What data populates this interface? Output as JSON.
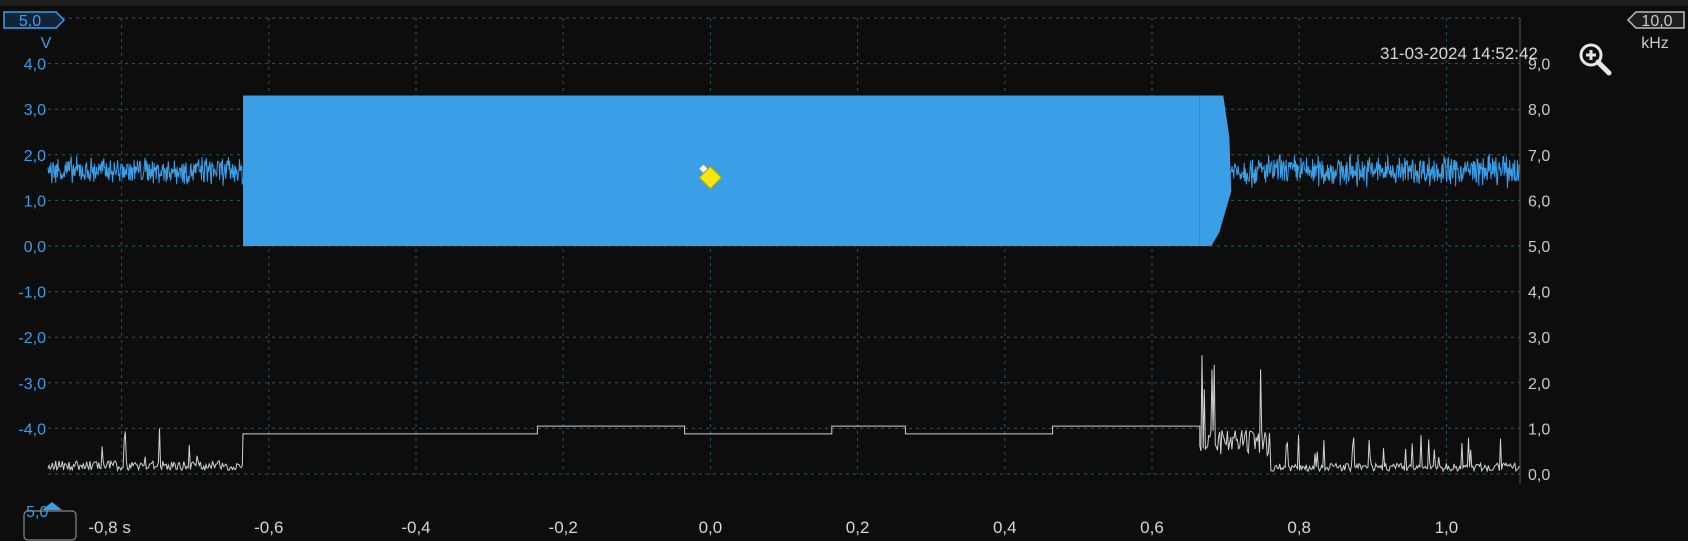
{
  "timestamp": "31-03-2024 14:52:42",
  "colors": {
    "channel_a": "#3b9fe8",
    "frequency_trace": "#d0d0d0",
    "grid": "#2e5a5a",
    "trigger_marker": "#f5e614",
    "background": "#0d0d0d"
  },
  "icons": {
    "zoom": "zoom-in-magnifier-icon"
  },
  "left_axis": {
    "unit": "V",
    "range_badge": "5,0",
    "bottom_label": "5,0",
    "ticks": [
      "4,0",
      "3,0",
      "2,0",
      "1,0",
      "0,0",
      "-1,0",
      "-2,0",
      "-3,0",
      "-4,0"
    ]
  },
  "right_axis": {
    "unit": "kHz",
    "range_badge": "10,0",
    "ticks": [
      "9,0",
      "8,0",
      "7,0",
      "6,0",
      "5,0",
      "4,0",
      "3,0",
      "2,0",
      "1,0",
      "0,0"
    ]
  },
  "x_axis": {
    "ticks": [
      "-0,8 s",
      "-0,6",
      "-0,4",
      "-0,2",
      "0,0",
      "0,2",
      "0,4",
      "0,6",
      "0,8",
      "1,0"
    ]
  },
  "chart_data": {
    "type": "line",
    "xlim": [
      -0.9,
      1.1
    ],
    "grid": true,
    "series": [
      {
        "axis": "left",
        "unit": "V",
        "ylim": [
          -5.0,
          5.0
        ],
        "segments": [
          {
            "from": -0.9,
            "to": -0.635,
            "kind": "noise",
            "center": 1.65,
            "amplitude": 0.35
          },
          {
            "from": -0.635,
            "to": 0.665,
            "kind": "band",
            "min": 0.0,
            "max": 3.3
          },
          {
            "from": 0.665,
            "to": 0.705,
            "kind": "transition",
            "min": 0.0,
            "max": 3.3
          },
          {
            "from": 0.705,
            "to": 1.1,
            "kind": "noise",
            "center": 1.65,
            "amplitude": 0.4
          }
        ]
      },
      {
        "axis": "right",
        "unit": "kHz",
        "ylim": [
          0.0,
          10.0
        ],
        "segments": [
          {
            "from": -0.9,
            "to": -0.635,
            "kind": "noise",
            "center": 0.2,
            "amplitude": 0.6
          },
          {
            "from": -0.635,
            "to": -0.235,
            "kind": "level",
            "value": 0.88
          },
          {
            "from": -0.235,
            "to": -0.035,
            "kind": "level",
            "value": 1.05
          },
          {
            "from": -0.035,
            "to": 0.165,
            "kind": "level",
            "value": 0.88
          },
          {
            "from": 0.165,
            "to": 0.265,
            "kind": "level",
            "value": 1.05
          },
          {
            "from": 0.265,
            "to": 0.465,
            "kind": "level",
            "value": 0.88
          },
          {
            "from": 0.465,
            "to": 0.665,
            "kind": "level",
            "value": 1.05
          },
          {
            "from": 0.665,
            "to": 0.76,
            "kind": "noise",
            "center": 1.0,
            "amplitude": 1.6
          },
          {
            "from": 0.76,
            "to": 1.1,
            "kind": "noise",
            "center": 0.15,
            "amplitude": 0.5
          }
        ]
      }
    ],
    "trigger": {
      "x": 0.0,
      "y": 1.5
    }
  }
}
